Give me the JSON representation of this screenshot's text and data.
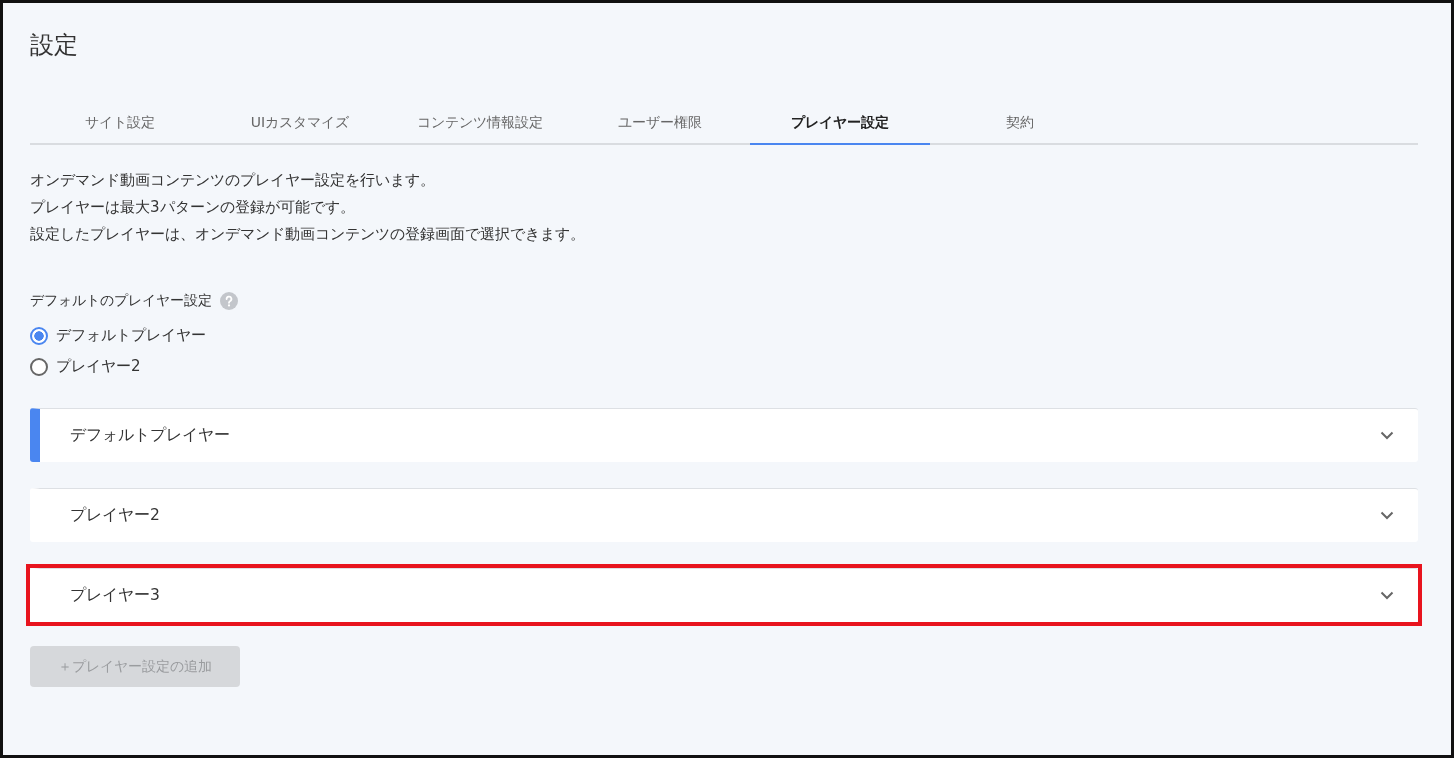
{
  "title": "設定",
  "tabs": [
    {
      "label": "サイト設定",
      "selected": false
    },
    {
      "label": "UIカスタマイズ",
      "selected": false
    },
    {
      "label": "コンテンツ情報設定",
      "selected": false
    },
    {
      "label": "ユーザー権限",
      "selected": false
    },
    {
      "label": "プレイヤー設定",
      "selected": true
    },
    {
      "label": "契約",
      "selected": false
    }
  ],
  "description": [
    "オンデマンド動画コンテンツのプレイヤー設定を行います。",
    "プレイヤーは最大3パターンの登録が可能です。",
    "設定したプレイヤーは、オンデマンド動画コンテンツの登録画面で選択できます。"
  ],
  "default_player": {
    "label": "デフォルトのプレイヤー設定",
    "options": [
      {
        "label": "デフォルトプレイヤー",
        "selected": true
      },
      {
        "label": "プレイヤー2",
        "selected": false
      }
    ]
  },
  "panels": [
    {
      "title": "デフォルトプレイヤー",
      "accent": true,
      "highlighted": false
    },
    {
      "title": "プレイヤー2",
      "accent": false,
      "highlighted": false
    },
    {
      "title": "プレイヤー3",
      "accent": false,
      "highlighted": true
    }
  ],
  "add_button": {
    "label": "＋プレイヤー設定の追加",
    "disabled": true
  }
}
